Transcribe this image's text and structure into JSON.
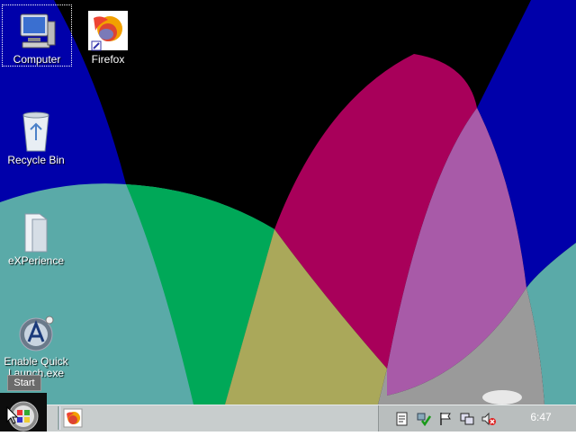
{
  "desktop": {
    "icons": [
      {
        "label": "Computer"
      },
      {
        "label": "Firefox"
      },
      {
        "label": "Recycle Bin"
      },
      {
        "label": "eXPerience"
      },
      {
        "label": "Enable Quick Launch.exe"
      }
    ]
  },
  "taskbar": {
    "start_tooltip": "Start",
    "clock": "6:47"
  },
  "colors": {
    "taskbar": "#c8cdcd",
    "wallpaper_blue": "#0000aa",
    "wallpaper_teal": "#5aaaa8",
    "wallpaper_green": "#00a858",
    "wallpaper_magenta": "#a8005a",
    "wallpaper_olive": "#aaa85a",
    "wallpaper_purple": "#a85aa8"
  }
}
